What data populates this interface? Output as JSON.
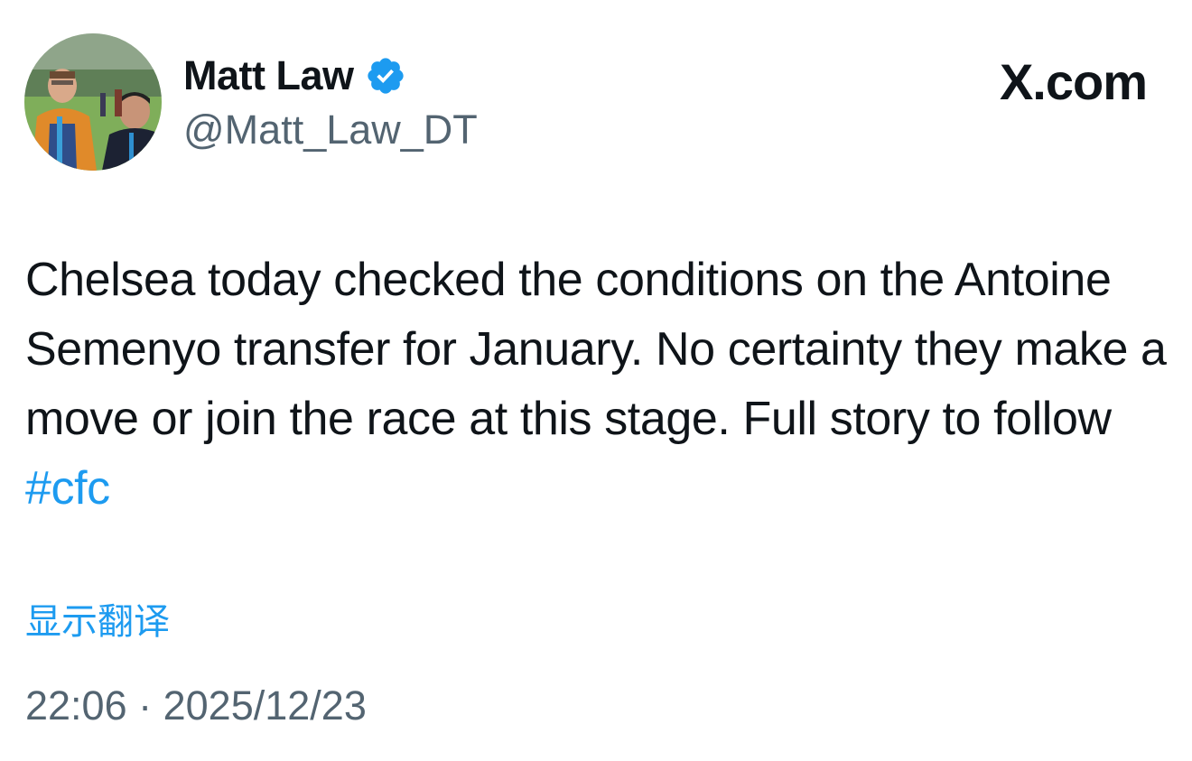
{
  "author": {
    "display_name": "Matt Law",
    "handle": "@Matt_Law_DT",
    "verified": true,
    "avatar_icon": "profile-photo"
  },
  "site_mark": "X.com",
  "tweet": {
    "text": "Chelsea today checked the conditions on the Antoine Semenyo transfer for January. No certainty they make a move or join the race at this stage. Full story to follow ",
    "hashtag": "#cfc"
  },
  "translate_label": "显示翻译",
  "meta": {
    "time": "22:06",
    "separator": " · ",
    "date": "2025/12/23"
  },
  "colors": {
    "link": "#1d9bf0",
    "secondary_text": "#536471",
    "primary_text": "#0f1419",
    "verified_badge": "#1d9bf0"
  }
}
